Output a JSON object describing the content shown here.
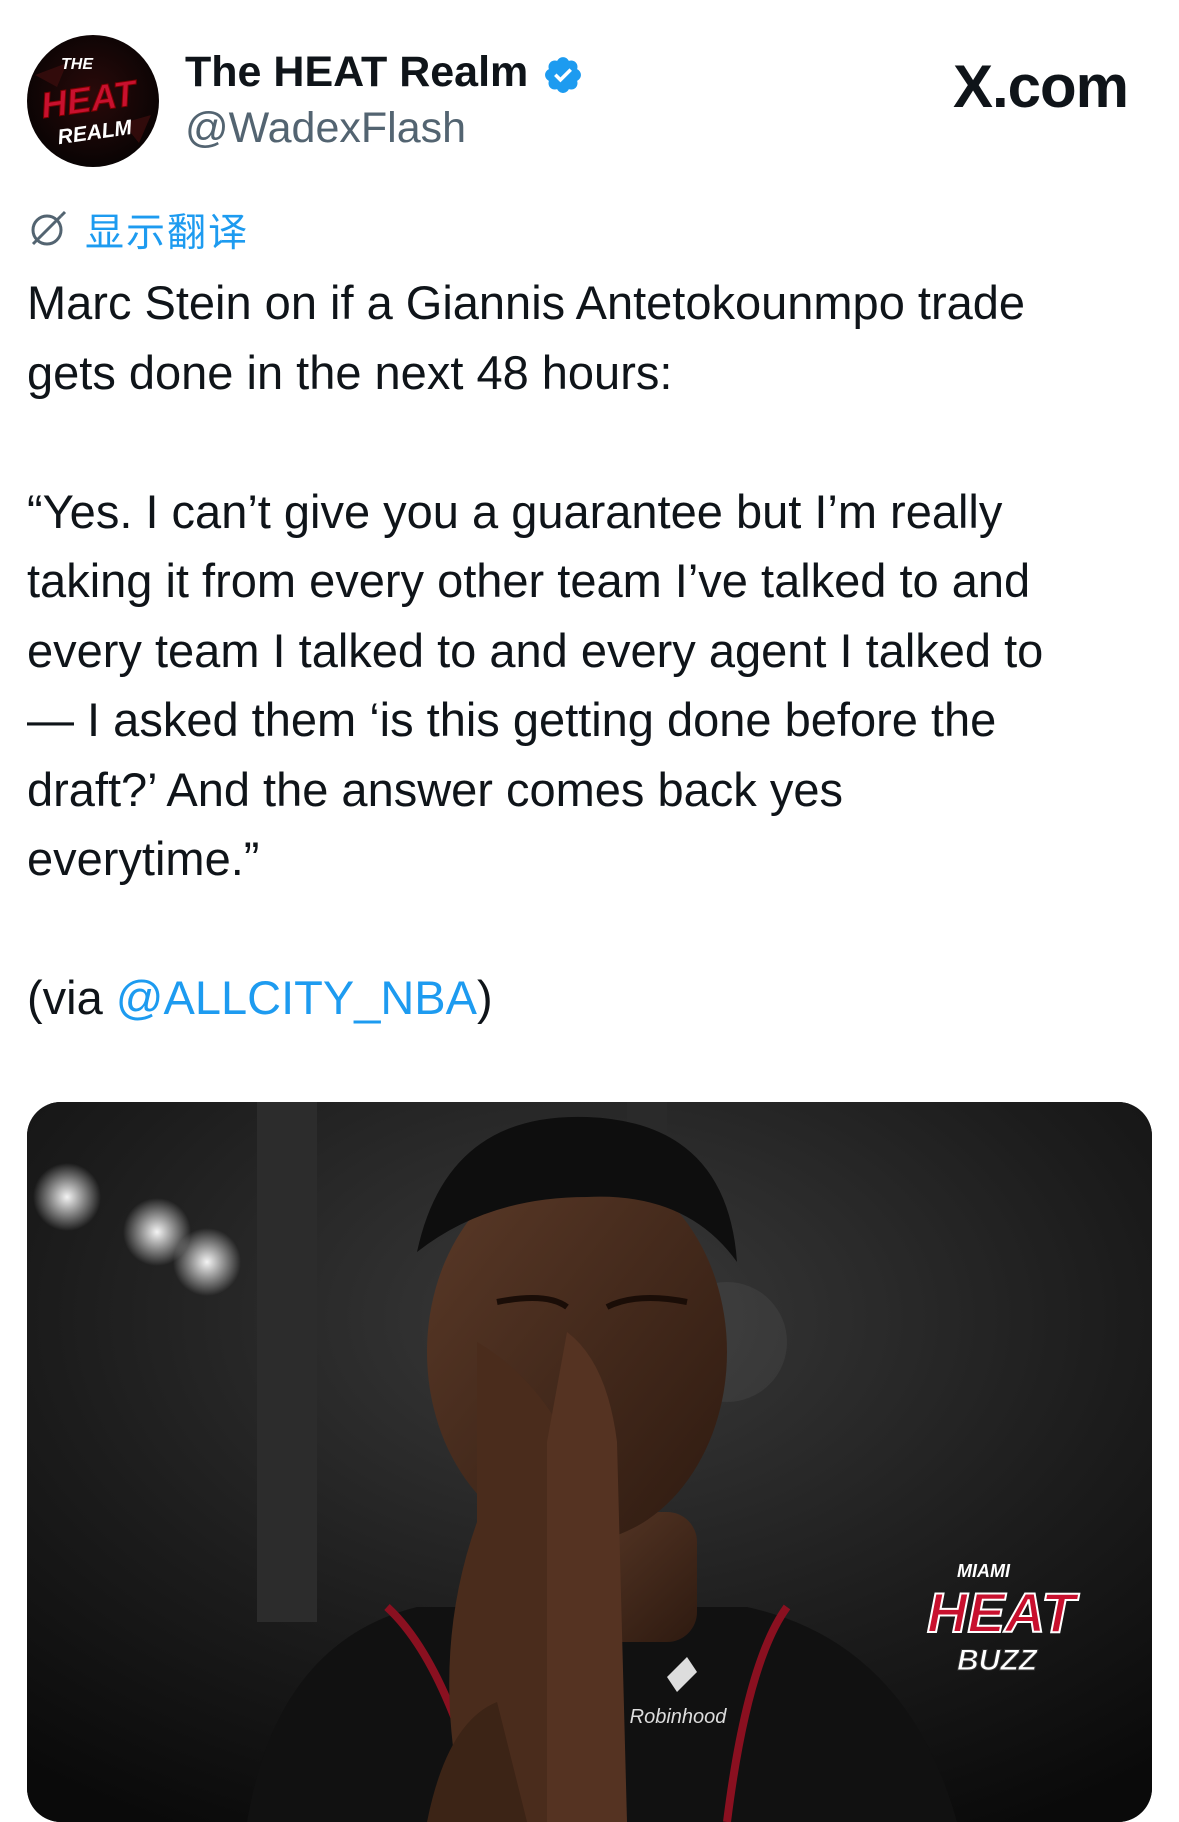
{
  "header": {
    "avatar_text": [
      "THE",
      "HEAT",
      "REALM"
    ],
    "display_name": "The HEAT Realm",
    "handle": "@WadexFlash",
    "site_label": "X.com",
    "verified_icon": "verified-badge-icon"
  },
  "translate": {
    "icon": "globe-slash-icon",
    "label": "显示翻译"
  },
  "tweet": {
    "lines": [
      "Marc Stein on if a Giannis Antetokounmpo trade",
      "gets done in the next 48 hours:",
      "",
      "“Yes. I can’t give you a guarantee but I’m really",
      "taking it from every other team I’ve talked to and",
      "every team I talked to and every agent I talked to",
      "— I asked them ‘is this getting done before the",
      "draft?’ And the answer comes back yes",
      "everytime.”",
      ""
    ],
    "via_prefix": "(via ",
    "via_mention": "@ALLCITY_NBA",
    "via_suffix": ")"
  },
  "media": {
    "watermark_lines": [
      "MIAMI",
      "HEAT",
      "BUZZ"
    ],
    "jersey_sponsor": "Robinhood"
  },
  "colors": {
    "link": "#1d9bf0",
    "text": "#0f1419",
    "secondary": "#536471",
    "heat_red": "#c8102e"
  }
}
